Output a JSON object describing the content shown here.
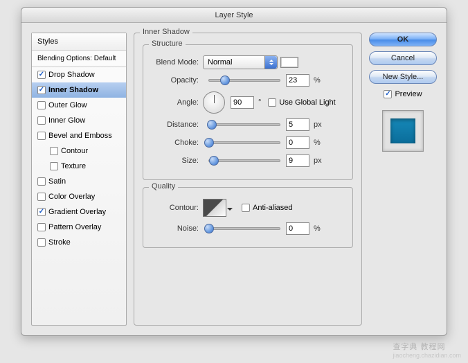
{
  "window": {
    "title": "Layer Style"
  },
  "sidebar": {
    "header": "Styles",
    "blending": "Blending Options: Default",
    "items": [
      {
        "label": "Drop Shadow",
        "checked": true,
        "selected": false,
        "sub": false
      },
      {
        "label": "Inner Shadow",
        "checked": true,
        "selected": true,
        "sub": false
      },
      {
        "label": "Outer Glow",
        "checked": false,
        "selected": false,
        "sub": false
      },
      {
        "label": "Inner Glow",
        "checked": false,
        "selected": false,
        "sub": false
      },
      {
        "label": "Bevel and Emboss",
        "checked": false,
        "selected": false,
        "sub": false
      },
      {
        "label": "Contour",
        "checked": false,
        "selected": false,
        "sub": true
      },
      {
        "label": "Texture",
        "checked": false,
        "selected": false,
        "sub": true
      },
      {
        "label": "Satin",
        "checked": false,
        "selected": false,
        "sub": false
      },
      {
        "label": "Color Overlay",
        "checked": false,
        "selected": false,
        "sub": false
      },
      {
        "label": "Gradient Overlay",
        "checked": true,
        "selected": false,
        "sub": false
      },
      {
        "label": "Pattern Overlay",
        "checked": false,
        "selected": false,
        "sub": false
      },
      {
        "label": "Stroke",
        "checked": false,
        "selected": false,
        "sub": false
      }
    ]
  },
  "panel": {
    "title": "Inner Shadow",
    "structure": "Structure",
    "quality": "Quality",
    "blend_mode_label": "Blend Mode:",
    "blend_mode_value": "Normal",
    "opacity_label": "Opacity:",
    "opacity_value": "23",
    "opacity_pct": 23,
    "pct": "%",
    "angle_label": "Angle:",
    "angle_value": "90",
    "angle_deg": "°",
    "use_global": "Use Global Light",
    "use_global_checked": false,
    "distance_label": "Distance:",
    "distance_value": "5",
    "distance_pct": 4,
    "choke_label": "Choke:",
    "choke_value": "0",
    "choke_pct": 0,
    "size_label": "Size:",
    "size_value": "9",
    "size_pct": 7,
    "px": "px",
    "contour_label": "Contour:",
    "anti_aliased": "Anti-aliased",
    "anti_aliased_checked": false,
    "noise_label": "Noise:",
    "noise_value": "0",
    "noise_pct": 0
  },
  "buttons": {
    "ok": "OK",
    "cancel": "Cancel",
    "newstyle": "New Style...",
    "preview": "Preview",
    "preview_checked": true
  },
  "colors": {
    "preview_swatch": "#0d7aab"
  },
  "watermark": {
    "text": "查字典 教程网",
    "sub": "jiaocheng.chazidian.com"
  }
}
